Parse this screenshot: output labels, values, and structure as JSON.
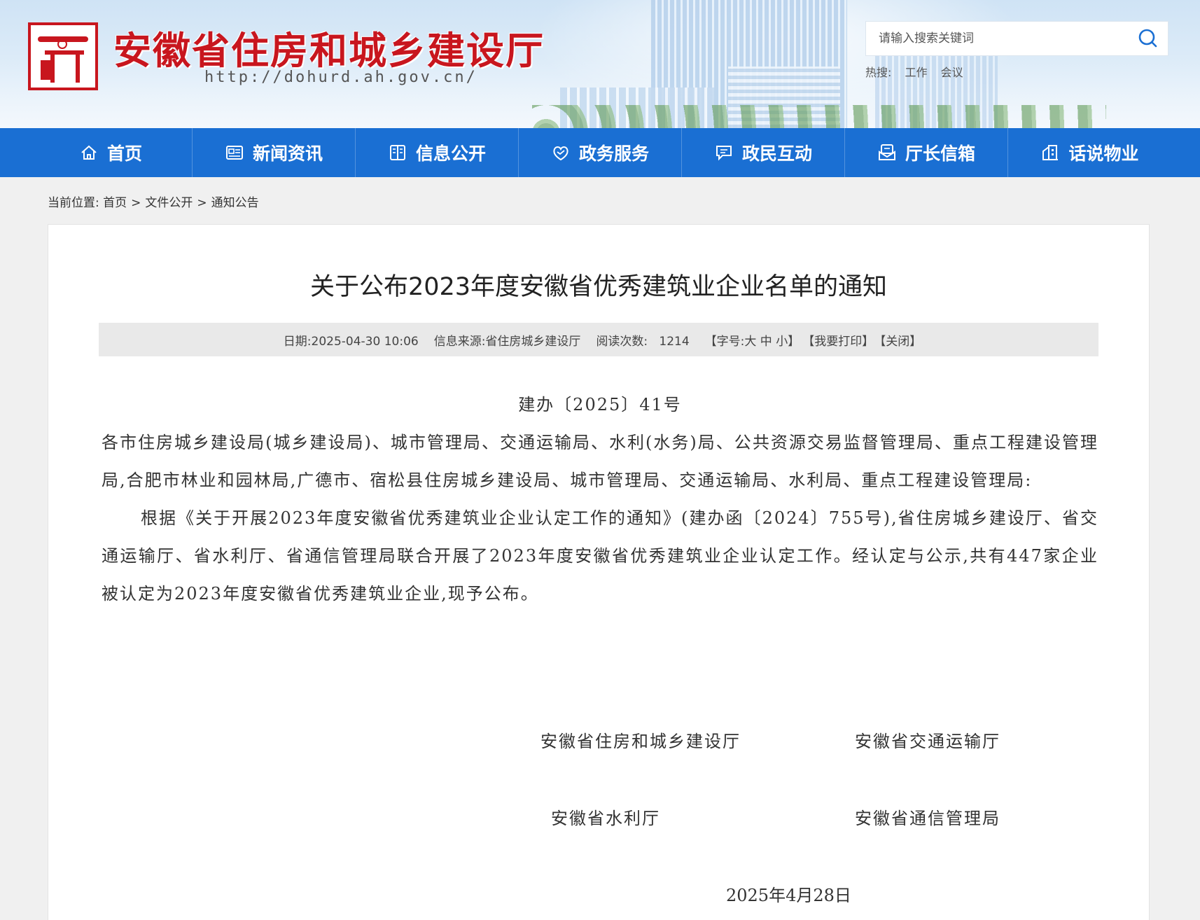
{
  "header": {
    "site_title": "安徽省住房和城乡建设厅",
    "site_url": "http://dohurd.ah.gov.cn/",
    "search_placeholder": "请输入搜索关键词",
    "hot_label": "热搜:",
    "hot_keywords": [
      "工作",
      "会议"
    ]
  },
  "nav": {
    "items": [
      {
        "label": "首页",
        "icon": "home-icon"
      },
      {
        "label": "新闻资讯",
        "icon": "news-icon"
      },
      {
        "label": "信息公开",
        "icon": "book-icon"
      },
      {
        "label": "政务服务",
        "icon": "service-icon"
      },
      {
        "label": "政民互动",
        "icon": "chat-icon"
      },
      {
        "label": "厅长信箱",
        "icon": "mailbox-icon"
      },
      {
        "label": "话说物业",
        "icon": "building-icon"
      }
    ]
  },
  "breadcrumb": {
    "label": "当前位置:",
    "items": [
      "首页",
      "文件公开",
      "通知公告"
    ],
    "separator": ">"
  },
  "article": {
    "title": "关于公布2023年度安徽省优秀建筑业企业名单的通知",
    "meta": {
      "date": "日期:2025-04-30 10:06",
      "source": "信息来源:省住房城乡建设厅",
      "views_label": "阅读次数:",
      "views": "1214",
      "font_label": "【字号:",
      "font_large": "大",
      "font_medium": "中",
      "font_small": "小】",
      "print": "【我要打印】",
      "close": "【关闭】"
    },
    "doc_number": "建办〔2025〕41号",
    "recipients": "各市住房城乡建设局(城乡建设局)、城市管理局、交通运输局、水利(水务)局、公共资源交易监督管理局、重点工程建设管理局,合肥市林业和园林局,广德市、宿松县住房城乡建设局、城市管理局、交通运输局、水利局、重点工程建设管理局:",
    "body": "根据《关于开展2023年度安徽省优秀建筑业企业认定工作的通知》(建办函〔2024〕755号),省住房城乡建设厅、省交通运输厅、省水利厅、省通信管理局联合开展了2023年度安徽省优秀建筑业企业认定工作。经认定与公示,共有447家企业被认定为2023年度安徽省优秀建筑业企业,现予公布。",
    "signatures": [
      "安徽省住房和城乡建设厅",
      "安徽省交通运输厅",
      "安徽省水利厅",
      "安徽省通信管理局"
    ],
    "sign_date": "2025年4月28日"
  },
  "colors": {
    "brand_red": "#c8161e",
    "nav_blue": "#1a6fd3",
    "search_icon": "#1a6fd3"
  }
}
